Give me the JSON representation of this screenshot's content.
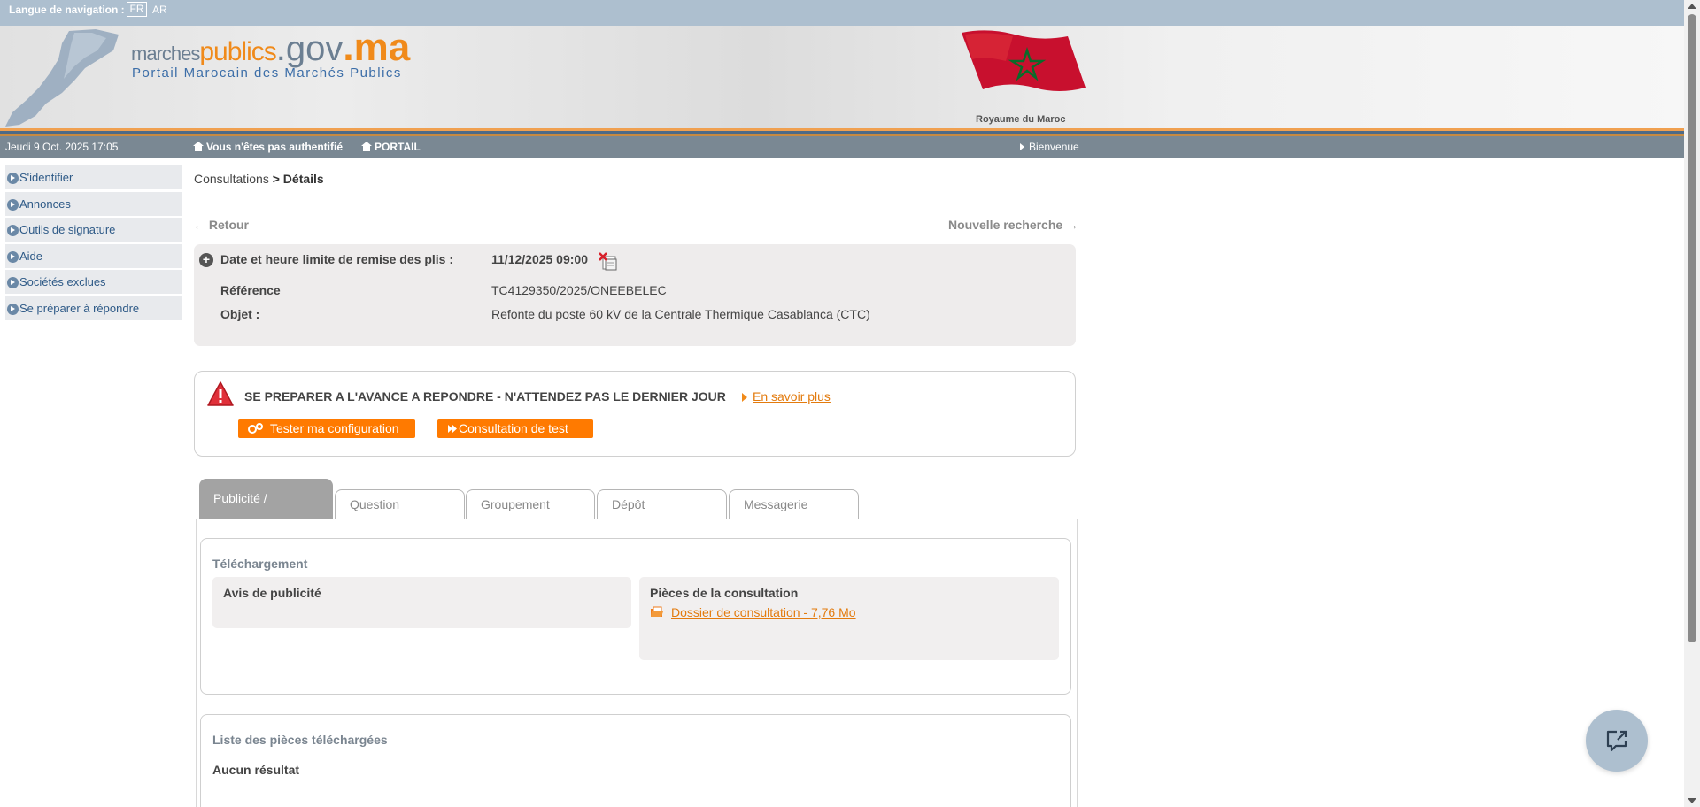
{
  "langbar": {
    "label": "Langue de navigation :",
    "fr": "FR",
    "ar": "AR"
  },
  "header": {
    "logo_marches": "marches",
    "logo_publics": "publics",
    "logo_gov": ".gov",
    "logo_ma": ".ma",
    "tagline": "Portail Marocain des Marchés Publics",
    "kingdom": "Royaume du Maroc"
  },
  "infobar": {
    "date": "Jeudi 9 Oct. 2025 17:05",
    "auth": "Vous n'êtes pas authentifié",
    "portail": "PORTAIL",
    "bienvenue": "Bienvenue"
  },
  "sidebar": {
    "items": [
      {
        "label": "S'identifier"
      },
      {
        "label": "Annonces"
      },
      {
        "label": "Outils de signature"
      },
      {
        "label": "Aide"
      },
      {
        "label": "Sociétés exclues"
      },
      {
        "label": "Se préparer à répondre"
      }
    ]
  },
  "breadcrumb": {
    "parent": "Consultations",
    "sep": " > ",
    "current": "Détails"
  },
  "nav": {
    "retour": "← Retour",
    "nouvelle": "Nouvelle recherche →"
  },
  "details": {
    "deadline_label": "Date et heure limite de remise des plis :",
    "deadline_value": "11/12/2025 09:00",
    "reference_label": "Référence",
    "reference_value": "TC4129350/2025/ONEEBELEC",
    "objet_label": "Objet :",
    "objet_value": "Refonte du poste 60 kV de la Centrale Thermique Casablanca (CTC)"
  },
  "warning": {
    "title": "SE PREPARER A L'AVANCE A REPONDRE - N'ATTENDEZ PAS LE DERNIER JOUR",
    "more": "En savoir plus",
    "btn_test": "Tester ma configuration",
    "btn_consultation": "Consultation de test"
  },
  "tabs": {
    "active": "Publicité /",
    "items": [
      {
        "label": "Question"
      },
      {
        "label": "Groupement"
      },
      {
        "label": "Dépôt"
      },
      {
        "label": "Messagerie"
      }
    ]
  },
  "telechargement": {
    "title": "Téléchargement",
    "avis_title": "Avis de publicité",
    "pieces_title": "Pièces de la consultation",
    "dossier_link": "Dossier de consultation - 7,76 Mo"
  },
  "liste": {
    "title": "Liste des pièces téléchargées",
    "empty": "Aucun résultat"
  },
  "colors": {
    "accent_orange": "#ff7a00",
    "link_orange": "#e37b0e",
    "topbar": "#adbfcf",
    "infobar": "#7a8893",
    "sidebar_text": "#2e5a87"
  },
  "icons": [
    "home-icon",
    "arrow-right-icon",
    "circle-arrow-icon",
    "plus-circle-icon",
    "calendar-icon",
    "warning-icon",
    "gears-icon",
    "fast-forward-icon",
    "folder-icon",
    "chat-icon"
  ]
}
